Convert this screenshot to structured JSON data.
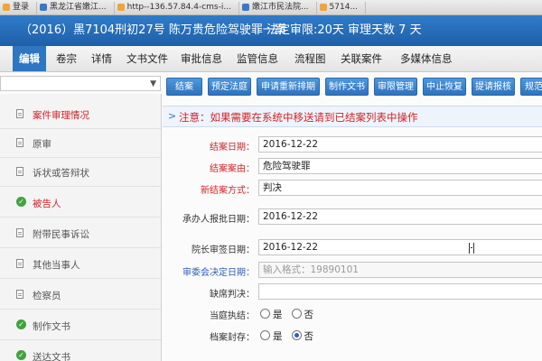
{
  "browser": {
    "tabs": [
      "登录",
      "黑龙江省嫩江...",
      "http--136.57.84.4-cms-i...",
      "嫩江市民法院...",
      "5714..."
    ]
  },
  "header": {
    "case_title": "（2016）黑7104刑初27号 陈万贵危险驾驶罪一案",
    "deadline": "法定审限:20天 审理天数 7 天"
  },
  "menu": {
    "items": [
      "编辑",
      "卷宗",
      "详情",
      "文书文件",
      "审批信息",
      "监管信息",
      "流程图",
      "关联案件",
      "多媒体信息"
    ]
  },
  "sidebar": {
    "dropdown_value": "",
    "items": [
      {
        "label": "案件审理情况",
        "icon": "document-icon",
        "red": true
      },
      {
        "label": "原审",
        "icon": "document-icon",
        "red": false
      },
      {
        "label": "诉状或答辩状",
        "icon": "document-icon",
        "red": false
      },
      {
        "label": "被告人",
        "icon": "check-circle-icon",
        "red": true
      },
      {
        "label": "附带民事诉讼",
        "icon": "document-icon",
        "red": false
      },
      {
        "label": "其他当事人",
        "icon": "document-icon",
        "red": false
      },
      {
        "label": "检察员",
        "icon": "document-icon",
        "red": false
      },
      {
        "label": "制作文书",
        "icon": "check-circle-icon",
        "red": false
      },
      {
        "label": "送达文书",
        "icon": "check-circle-icon",
        "red": false
      }
    ]
  },
  "toolbar": {
    "buttons": [
      "结案",
      "预定法庭",
      "申请重新排期",
      "制作文书",
      "审限管理",
      "中止恢复",
      "提请报核",
      "规范化管"
    ]
  },
  "notice": {
    "text": "注意：如果需要在系统中移送请到已结案列表中操作"
  },
  "form": {
    "close_date_label": "结案日期：",
    "close_date_value": "2016-12-22",
    "close_reason_label": "结案案由：",
    "close_reason_value": "危险驾驶罪",
    "close_method_label": "新结案方式：",
    "close_method_value": "判决",
    "report_date_label": "承办人报批日期：",
    "report_date_value": "2016-12-22",
    "president_date_label": "院长审签日期：",
    "president_date_value": "2016-12-22",
    "committee_date_label": "审委会决定日期：",
    "committee_date_placeholder": "输入格式：19890101",
    "absent_verdict_label": "缺席判决：",
    "absent_verdict_value": "",
    "court_exec_label": "当庭执结：",
    "court_exec_options": [
      "是",
      "否"
    ],
    "court_exec_selected": "",
    "archive_seal_label": "档案封存：",
    "archive_seal_options": [
      "是",
      "否"
    ],
    "archive_seal_selected": "否"
  }
}
